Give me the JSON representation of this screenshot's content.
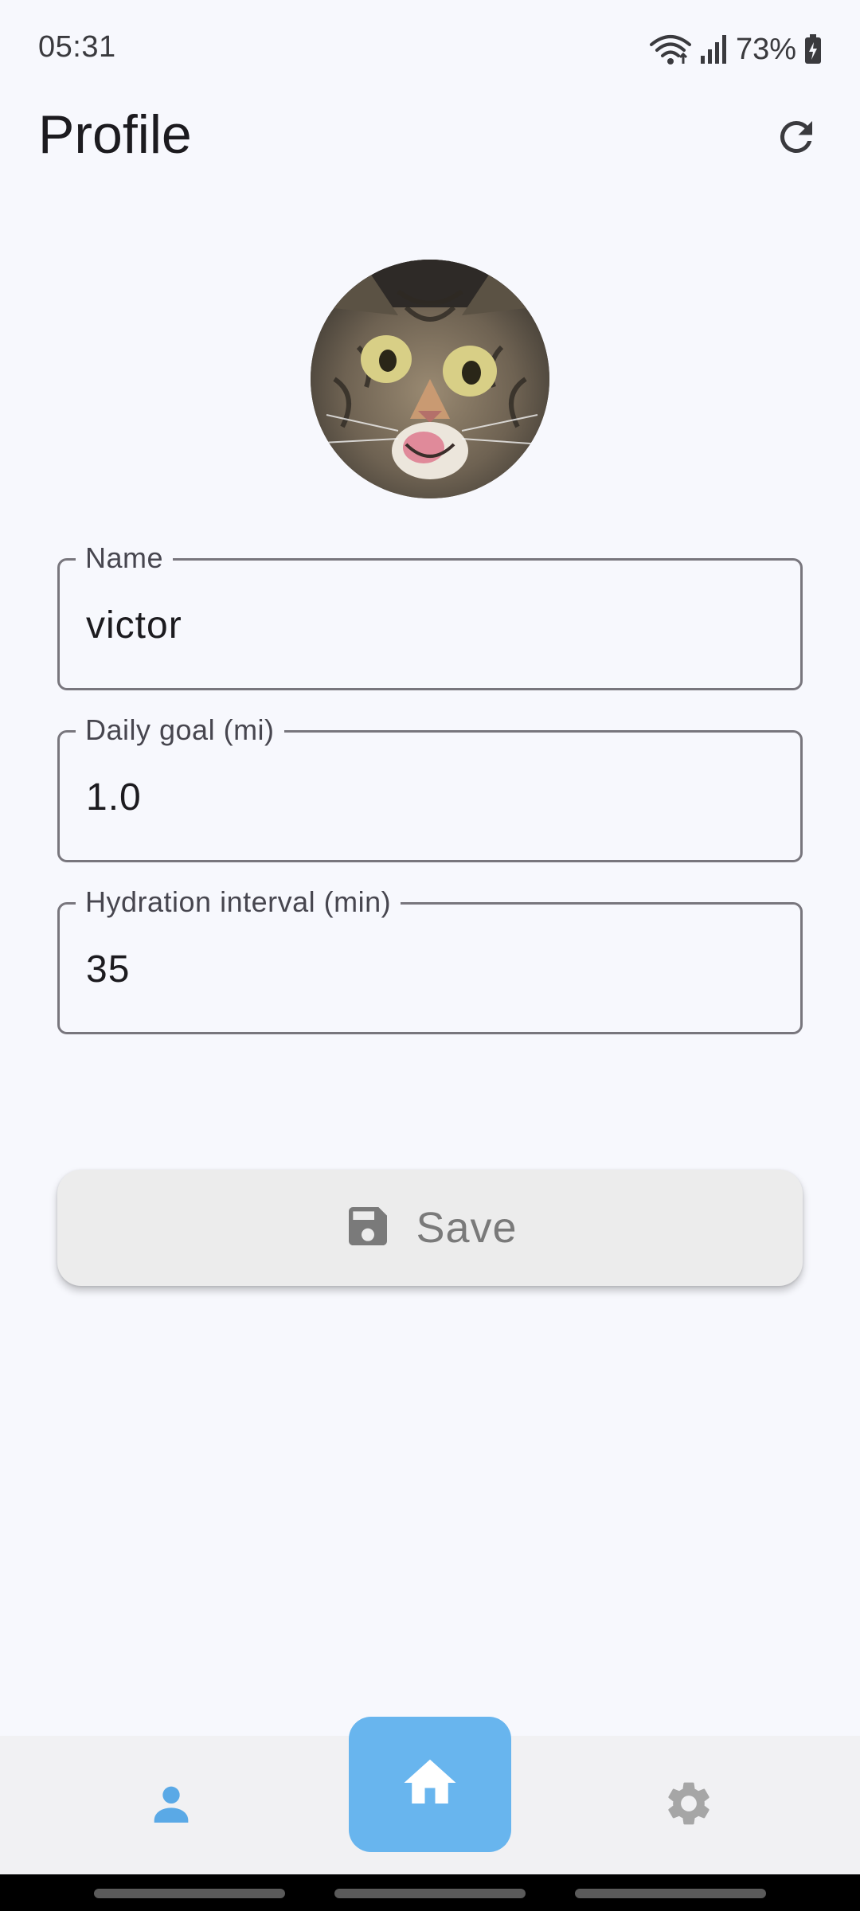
{
  "status_bar": {
    "time": "05:31",
    "battery": "73%",
    "icons": [
      "wifi-icon",
      "signal-icon",
      "battery-charging-icon"
    ]
  },
  "app_bar": {
    "title": "Profile",
    "action_icon": "refresh-icon"
  },
  "avatar": {
    "description_icon": "cat-photo"
  },
  "form": {
    "name": {
      "label": "Name",
      "value": "victor"
    },
    "daily_goal": {
      "label": "Daily goal (mi)",
      "value": "1.0"
    },
    "hydration_interval": {
      "label": "Hydration interval (min)",
      "value": "35"
    }
  },
  "save_button": {
    "label": "Save",
    "icon": "save-icon"
  },
  "bottom_nav": {
    "items": [
      {
        "icon": "person-icon",
        "active": false
      },
      {
        "icon": "home-icon",
        "active": true
      },
      {
        "icon": "gear-icon",
        "active": false
      }
    ]
  },
  "colors": {
    "background": "#f7f8fd",
    "accent": "#68b5ee",
    "outline": "#78767d",
    "save_bg": "#ececec",
    "nav_bg": "#f1f1f3"
  }
}
